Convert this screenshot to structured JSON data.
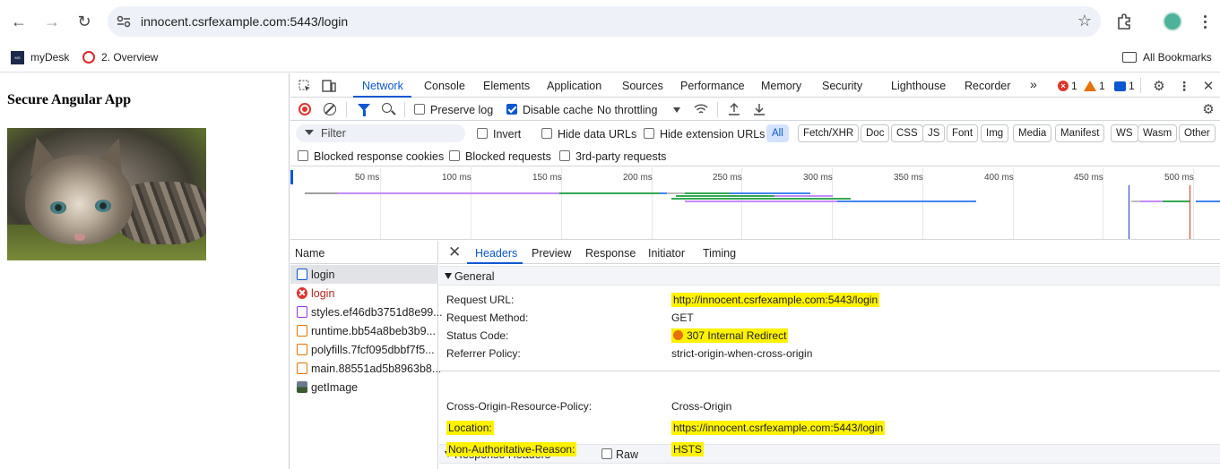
{
  "browser": {
    "url": "innocent.csrfexample.com:5443/login",
    "bookmarks": [
      {
        "label": "myDesk"
      },
      {
        "label": "2. Overview"
      }
    ],
    "all_bookmarks": "All Bookmarks",
    "profile_color": "#4db29a"
  },
  "page": {
    "title": "Secure Angular App"
  },
  "devtools": {
    "tabs": [
      "Network",
      "Console",
      "Elements",
      "Application",
      "Sources",
      "Performance",
      "Memory",
      "Security",
      "Lighthouse",
      "Recorder"
    ],
    "more": "»",
    "errors": "1",
    "warnings": "1",
    "messages": "1",
    "toolbar": {
      "preserve_log": "Preserve log",
      "disable_cache": "Disable cache",
      "throttling": "No throttling"
    },
    "filter": {
      "placeholder": "Filter",
      "invert": "Invert",
      "hide_data_urls": "Hide data URLs",
      "hide_extension_urls": "Hide extension URLs",
      "types": [
        "All",
        "Fetch/XHR",
        "Doc",
        "CSS",
        "JS",
        "Font",
        "Img",
        "Media",
        "Manifest",
        "WS",
        "Wasm",
        "Other"
      ],
      "blocked_cookies": "Blocked response cookies",
      "blocked_requests": "Blocked requests",
      "third_party": "3rd-party requests"
    },
    "timeline": {
      "ticks": [
        "50 ms",
        "100 ms",
        "150 ms",
        "200 ms",
        "250 ms",
        "300 ms",
        "350 ms",
        "400 ms",
        "450 ms",
        "500 ms"
      ]
    },
    "list": {
      "header": "Name",
      "rows": [
        {
          "name": "login",
          "type": "doc"
        },
        {
          "name": "login",
          "type": "error"
        },
        {
          "name": "styles.ef46db3751d8e99...",
          "type": "css"
        },
        {
          "name": "runtime.bb54a8beb3b9...",
          "type": "js"
        },
        {
          "name": "polyfills.7fcf095dbbf7f5...",
          "type": "js"
        },
        {
          "name": "main.88551ad5b8963b8...",
          "type": "js"
        },
        {
          "name": "getImage",
          "type": "img"
        }
      ]
    },
    "details": {
      "tabs": [
        "Headers",
        "Preview",
        "Response",
        "Initiator",
        "Timing"
      ],
      "general": {
        "title": "General",
        "request_url_k": "Request URL:",
        "request_url_v": "http://innocent.csrfexample.com:5443/login",
        "method_k": "Request Method:",
        "method_v": "GET",
        "status_k": "Status Code:",
        "status_v": "307 Internal Redirect",
        "referrer_k": "Referrer Policy:",
        "referrer_v": "strict-origin-when-cross-origin"
      },
      "response": {
        "title": "Response Headers",
        "raw": "Raw",
        "corp_k": "Cross-Origin-Resource-Policy:",
        "corp_v": "Cross-Origin",
        "location_k": "Location:",
        "location_v": "https://innocent.csrfexample.com:5443/login",
        "reason_k": "Non-Authoritative-Reason:",
        "reason_v": "HSTS"
      }
    }
  }
}
